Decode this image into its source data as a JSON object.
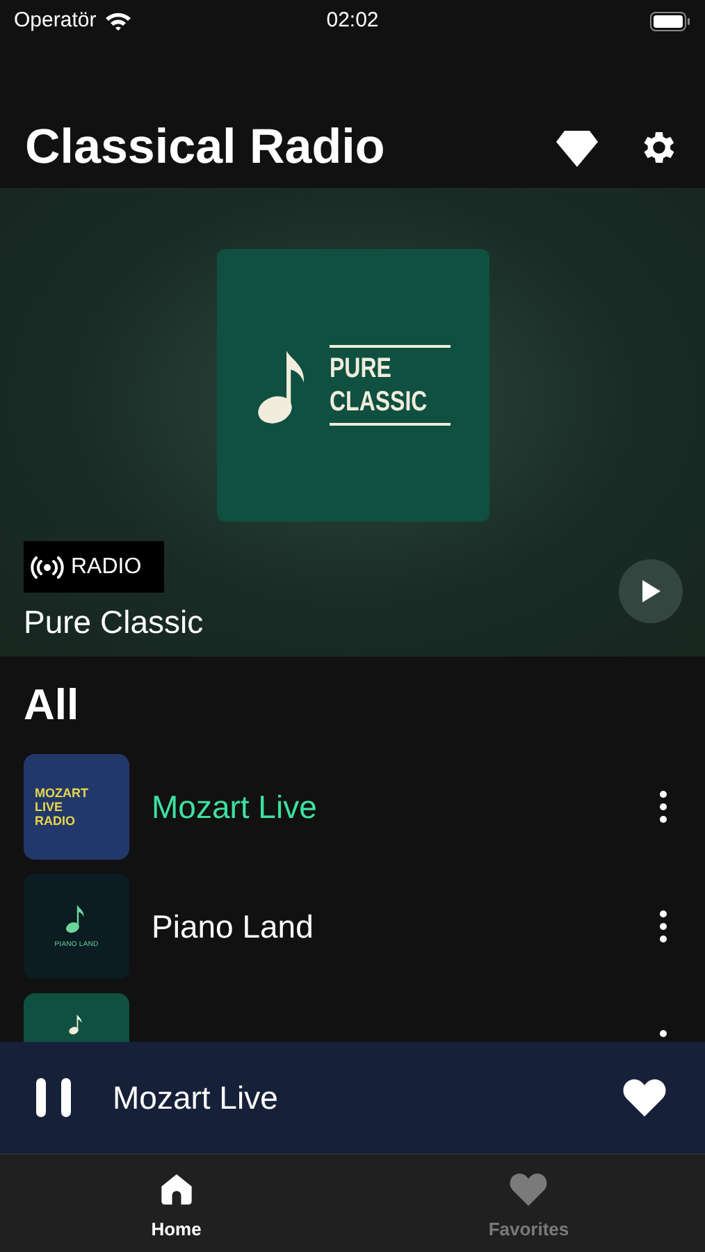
{
  "status_bar": {
    "carrier": "Operatör",
    "time": "02:02"
  },
  "header": {
    "title": "Classical Radio"
  },
  "featured": {
    "cover_lines": [
      "PURE",
      "CLASSIC"
    ],
    "badge": "RADIO",
    "title": "Pure Classic"
  },
  "section_title": "All",
  "stations": [
    {
      "name": "Mozart Live",
      "selected": true,
      "kind": "mozart",
      "cover_text": "MOZART\nLIVE\nRADIO"
    },
    {
      "name": "Piano Land",
      "selected": false,
      "kind": "piano",
      "cover_text": "PIANO LAND"
    },
    {
      "kind": "pure"
    }
  ],
  "player": {
    "title": "Mozart Live",
    "playing": true,
    "favorite": true
  },
  "tabs": [
    {
      "label": "Home",
      "selected": true,
      "kind": "home"
    },
    {
      "label": "Favorites",
      "selected": false,
      "kind": "heart"
    }
  ]
}
